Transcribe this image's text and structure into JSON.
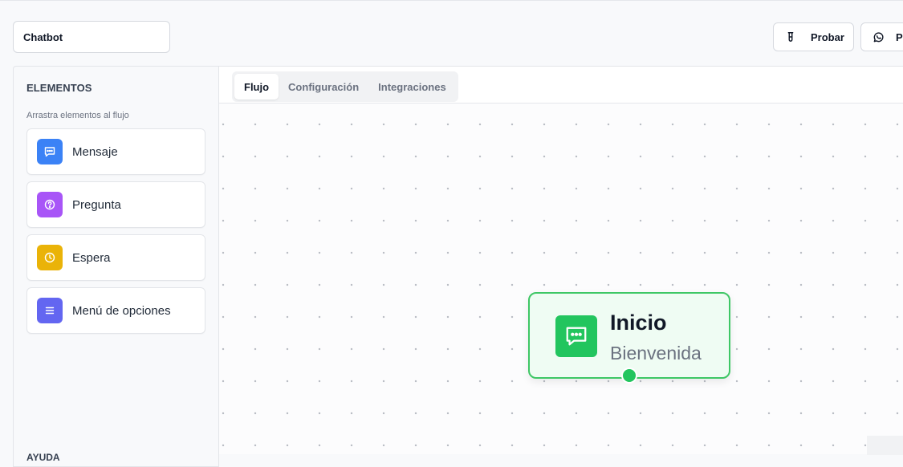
{
  "header": {
    "bot_name": "Chatbot",
    "test_button": "Probar",
    "whatsapp_button": "P"
  },
  "sidebar": {
    "title": "ELEMENTOS",
    "subtitle": "Arrastra elementos al flujo",
    "items": [
      {
        "label": "Mensaje",
        "icon": "message-icon",
        "color": "#3b82f6"
      },
      {
        "label": "Pregunta",
        "icon": "question-icon",
        "color": "#a855f7"
      },
      {
        "label": "Espera",
        "icon": "clock-icon",
        "color": "#eab308"
      },
      {
        "label": "Menú de opciones",
        "icon": "menu-icon",
        "color": "#6366f1"
      }
    ],
    "help_label": "AYUDA"
  },
  "tabs": [
    {
      "label": "Flujo",
      "active": true
    },
    {
      "label": "Configuración",
      "active": false
    },
    {
      "label": "Integraciones",
      "active": false
    }
  ],
  "flow": {
    "start_node": {
      "title": "Inicio",
      "subtitle": "Bienvenida",
      "icon": "message-icon",
      "color": "#22c55e"
    }
  }
}
